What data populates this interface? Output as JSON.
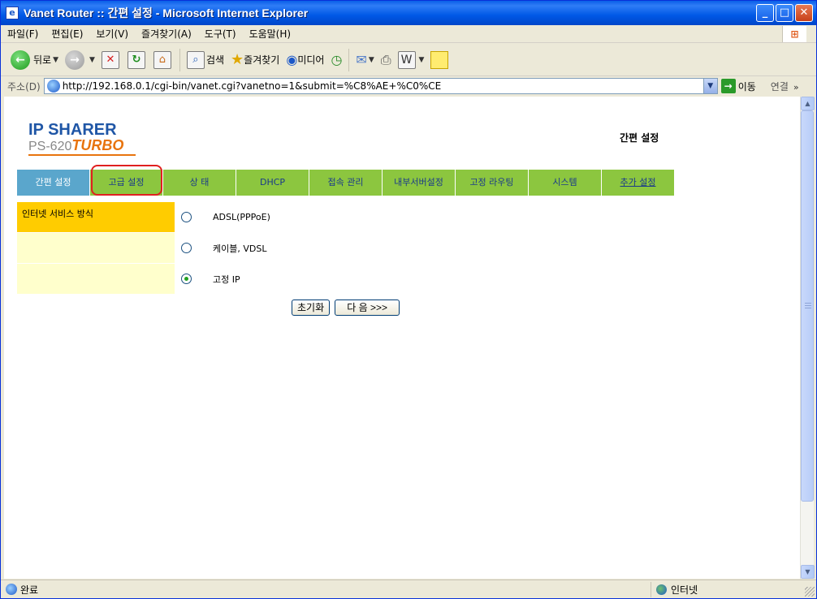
{
  "window": {
    "title": "Vanet Router :: 간편 설정 - Microsoft Internet Explorer",
    "minimize": "_",
    "maximize": "□",
    "close": "✕"
  },
  "menu": [
    "파일(F)",
    "편집(E)",
    "보기(V)",
    "즐겨찾기(A)",
    "도구(T)",
    "도움말(H)"
  ],
  "toolbar": {
    "back": "뒤로",
    "search": "검색",
    "favorites": "즐겨찾기",
    "media": "미디어"
  },
  "address": {
    "label": "주소(D)",
    "url": "http://192.168.0.1/cgi-bin/vanet.cgi?vanetno=1&submit=%C8%AE+%C0%CE",
    "go": "이동",
    "links": "연결"
  },
  "logo": {
    "line1": "IP SHARER",
    "model": "PS-620",
    "turbo": "TURBO"
  },
  "page_heading": "간편 설정",
  "tabs": [
    {
      "label": "간편 설정",
      "active": true
    },
    {
      "label": "고급 설정",
      "active": false
    },
    {
      "label": "상 태",
      "active": false
    },
    {
      "label": "DHCP",
      "active": false
    },
    {
      "label": "접속 관리",
      "active": false
    },
    {
      "label": "내부서버설정",
      "active": false
    },
    {
      "label": "고정 라우팅",
      "active": false
    },
    {
      "label": "시스템",
      "active": false
    },
    {
      "label": "추가 설정",
      "active": false
    }
  ],
  "form": {
    "section_label": "인터넷 서비스 방식",
    "options": [
      {
        "label": "ADSL(PPPoE)",
        "checked": false
      },
      {
        "label": "케이블, VDSL",
        "checked": false
      },
      {
        "label": "고정 IP",
        "checked": true
      }
    ]
  },
  "buttons": {
    "reset": "초기화",
    "next": "다 음 >>>"
  },
  "status": {
    "text": "완료",
    "zone": "인터넷"
  }
}
